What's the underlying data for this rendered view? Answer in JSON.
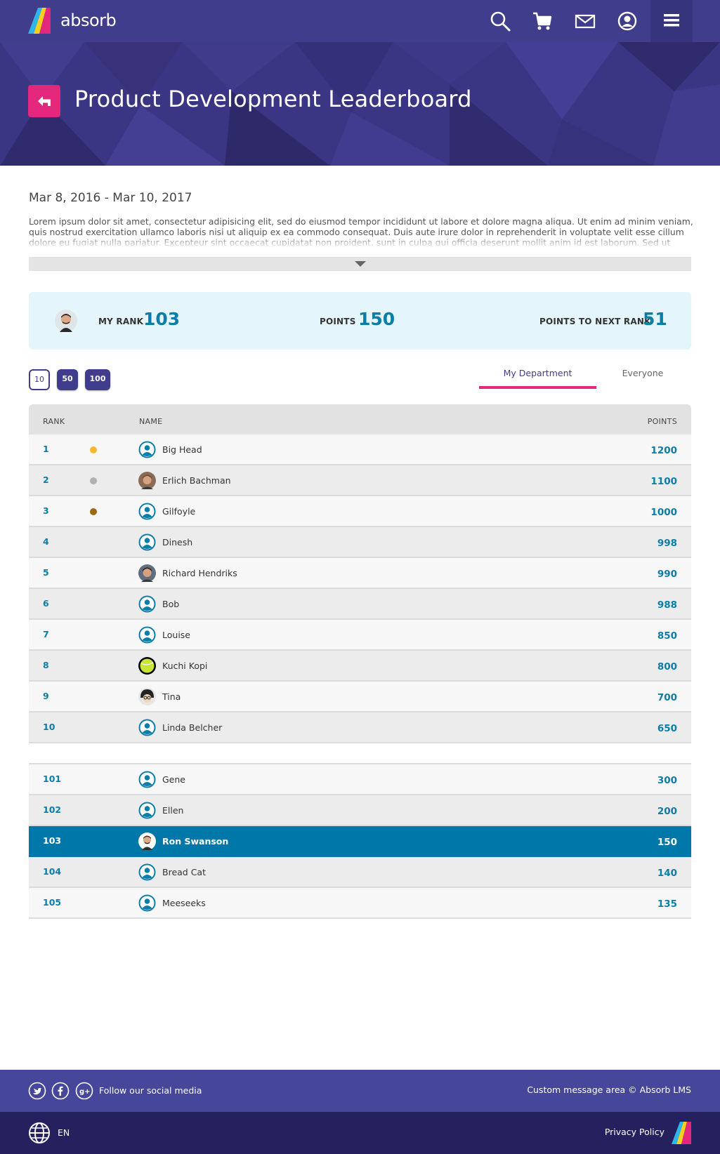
{
  "header": {
    "brand": "absorb",
    "icons": [
      "search-icon",
      "cart-icon",
      "mail-icon",
      "profile-icon",
      "menu-icon"
    ]
  },
  "banner": {
    "title": "Product Development Leaderboard",
    "back_icon": "back-arrow-icon"
  },
  "content": {
    "date_range": "Mar 8, 2016 - Mar 10, 2017",
    "description": "Lorem ipsum dolor sit amet, consectetur adipisicing elit, sed do eiusmod tempor incididunt ut labore et dolore magna aliqua. Ut enim ad minim veniam, quis nostrud exercitation ullamco laboris nisi ut aliquip ex ea commodo consequat. Duis aute irure dolor in reprehenderit in voluptate velit esse cillum dolore eu fugiat nulla pariatur. Excepteur sint occaecat cupidatat non proident, sunt in culpa qui officia deserunt mollit anim id est laborum. Sed ut perspiciatis unde"
  },
  "stats": {
    "my_rank_label": "MY RANK",
    "my_rank": "103",
    "points_label": "POINTS",
    "points": "150",
    "next_rank_label": "POINTS TO NEXT RANK",
    "next_rank": "51"
  },
  "page_sizes": [
    "10",
    "50",
    "100"
  ],
  "tabs": {
    "my_department": "My Department",
    "everyone": "Everyone"
  },
  "table": {
    "headers": {
      "rank": "RANK",
      "name": "NAME",
      "points": "POINTS"
    },
    "top_rows": [
      {
        "rank": "1",
        "medal": "gold",
        "avatar": "default",
        "name": "Big Head",
        "points": "1200"
      },
      {
        "rank": "2",
        "medal": "silver",
        "avatar": "photo-erlich",
        "name": "Erlich Bachman",
        "points": "1100"
      },
      {
        "rank": "3",
        "medal": "bronze",
        "avatar": "default",
        "name": "Gilfoyle",
        "points": "1000"
      },
      {
        "rank": "4",
        "medal": "",
        "avatar": "default",
        "name": "Dinesh",
        "points": "998"
      },
      {
        "rank": "5",
        "medal": "",
        "avatar": "photo-richard",
        "name": "Richard Hendriks",
        "points": "990"
      },
      {
        "rank": "6",
        "medal": "",
        "avatar": "default",
        "name": "Bob",
        "points": "988"
      },
      {
        "rank": "7",
        "medal": "",
        "avatar": "default",
        "name": "Louise",
        "points": "850"
      },
      {
        "rank": "8",
        "medal": "",
        "avatar": "photo-tennis",
        "name": "Kuchi Kopi",
        "points": "800"
      },
      {
        "rank": "9",
        "medal": "",
        "avatar": "photo-tina",
        "name": "Tina",
        "points": "700"
      },
      {
        "rank": "10",
        "medal": "",
        "avatar": "default",
        "name": "Linda Belcher",
        "points": "650"
      }
    ],
    "bottom_rows": [
      {
        "rank": "101",
        "avatar": "default",
        "name": "Gene",
        "points": "300",
        "me": false
      },
      {
        "rank": "102",
        "avatar": "default",
        "name": "Ellen",
        "points": "200",
        "me": false
      },
      {
        "rank": "103",
        "avatar": "photo-ron",
        "name": "Ron Swanson",
        "points": "150",
        "me": true
      },
      {
        "rank": "104",
        "avatar": "default",
        "name": "Bread Cat",
        "points": "140",
        "me": false
      },
      {
        "rank": "105",
        "avatar": "default",
        "name": "Meeseeks",
        "points": "135",
        "me": false
      }
    ]
  },
  "footer": {
    "follow": "Follow our social media",
    "custom_message": "Custom message area © Absorb LMS",
    "language": "EN",
    "privacy": "Privacy Policy",
    "social_icons": [
      "twitter-icon",
      "facebook-icon",
      "google-plus-icon"
    ]
  },
  "colors": {
    "primary": "#3f3d8c",
    "accent": "#e2277c",
    "highlight": "#0077a9",
    "value_blue": "#0a7ea8",
    "gold": "#f5b82e",
    "silver": "#b0b0b0",
    "bronze": "#9a6a12"
  }
}
